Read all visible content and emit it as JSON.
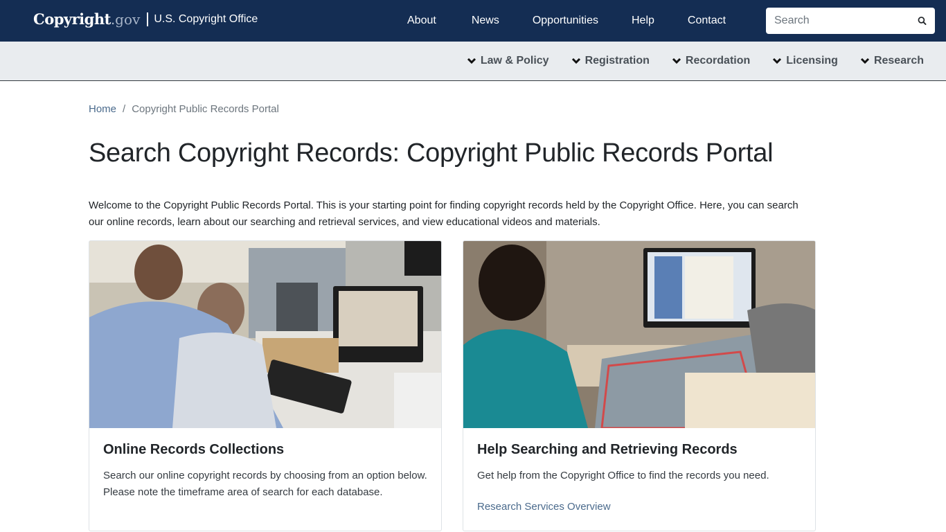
{
  "header": {
    "logo_main": "Copyright",
    "logo_gov": ".gov",
    "logo_office": "U.S. Copyright Office",
    "nav": [
      "About",
      "News",
      "Opportunities",
      "Help",
      "Contact"
    ],
    "search_placeholder": "Search"
  },
  "subnav": [
    "Law & Policy",
    "Registration",
    "Recordation",
    "Licensing",
    "Research"
  ],
  "breadcrumb": {
    "home": "Home",
    "separator": "/",
    "current": "Copyright Public Records Portal"
  },
  "page_title": "Search Copyright Records: Copyright Public Records Portal",
  "intro": "Welcome to the Copyright Public Records Portal. This is your starting point for finding copyright records held by the Copyright Office. Here, you can search our online records, learn about our searching and retrieval services, and view educational videos and materials.",
  "cards": [
    {
      "title": "Online Records Collections",
      "text": "Search our online copyright records by choosing from an option below. Please note the timeframe area of search for each database.",
      "image_alt": "Two men viewing records on a computer in a records office"
    },
    {
      "title": "Help Searching and Retrieving Records",
      "text": "Get help from the Copyright Office to find the records you need.",
      "link": "Research Services Overview",
      "image_alt": "Woman viewing a scanned copyright record on a computer monitor"
    }
  ],
  "colors": {
    "header_bg": "#142d53",
    "subnav_bg": "#e9ecef",
    "link": "#4a6a8c"
  }
}
